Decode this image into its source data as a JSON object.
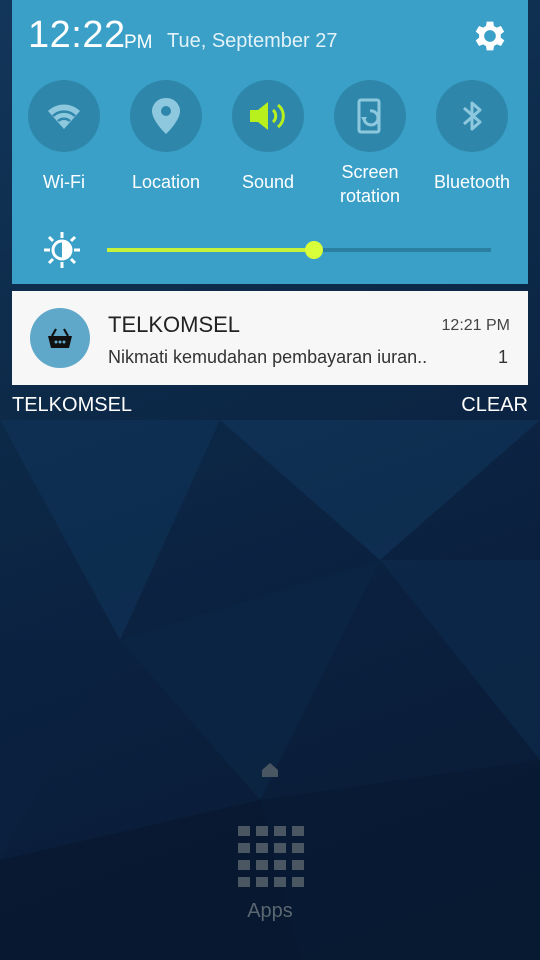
{
  "status": {
    "time": "12:22",
    "ampm": "PM",
    "date": "Tue, September 27"
  },
  "quick_settings": [
    {
      "label": "Wi-Fi",
      "icon": "wifi-icon",
      "active": false
    },
    {
      "label": "Location",
      "icon": "location-icon",
      "active": false
    },
    {
      "label": "Sound",
      "icon": "sound-icon",
      "active": true
    },
    {
      "label": "Screen\nrotation",
      "icon": "screen-rotation-icon",
      "active": false
    },
    {
      "label": "Bluetooth",
      "icon": "bluetooth-icon",
      "active": false
    }
  ],
  "brightness": {
    "level": 0.54
  },
  "notification": {
    "title": "TELKOMSEL",
    "time": "12:21 PM",
    "message": "Nikmati kemudahan pembayaran iuran..",
    "count": "1",
    "icon": "shopping-basket-icon"
  },
  "footer": {
    "carrier": "TELKOMSEL",
    "clear_label": "CLEAR"
  },
  "home": {
    "apps_label": "Apps"
  },
  "colors": {
    "panel": "#3aa0c8",
    "accent": "#c7f23a"
  }
}
